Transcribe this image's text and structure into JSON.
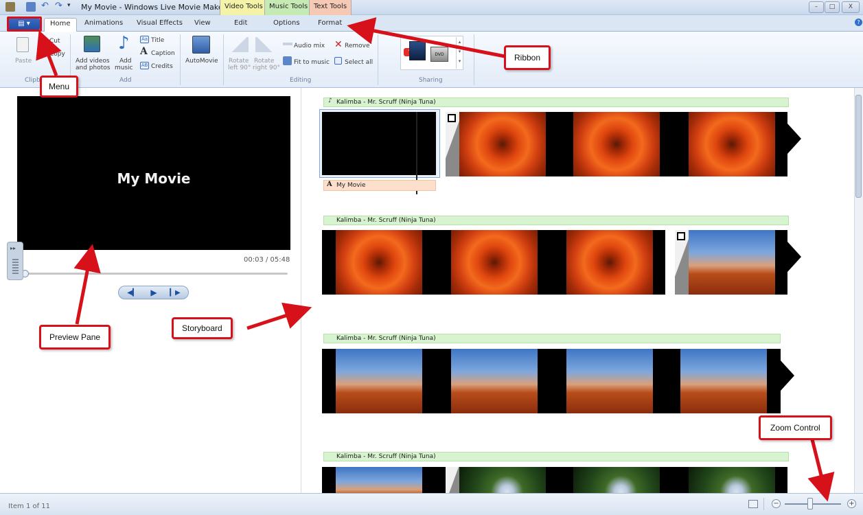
{
  "window": {
    "title": "My Movie - Windows Live Movie Maker",
    "context_tabs": {
      "video": "Video Tools",
      "music": "Music Tools",
      "text": "Text Tools"
    },
    "minimize": "–",
    "maximize": "□",
    "close": "X"
  },
  "tabs": [
    {
      "label": "Home"
    },
    {
      "label": "Animations"
    },
    {
      "label": "Visual Effects"
    },
    {
      "label": "View"
    },
    {
      "label": "Edit"
    },
    {
      "label": "Options"
    },
    {
      "label": "Format"
    }
  ],
  "ribbon": {
    "clipboard": {
      "paste": "Paste",
      "cut": "Cut",
      "copy": "Copy",
      "group": "Clipb"
    },
    "add": {
      "add_videos_1": "Add videos",
      "add_videos_2": "and photos",
      "add_music_1": "Add",
      "add_music_2": "music",
      "title": "Title",
      "caption": "Caption",
      "credits": "Credits",
      "group": "Add"
    },
    "automovie": "AutoMovie",
    "editing": {
      "rotate_left_1": "Rotate",
      "rotate_left_2": "left 90°",
      "rotate_right_1": "Rotate",
      "rotate_right_2": "right 90°",
      "audio_mix": "Audio mix",
      "remove": "Remove",
      "fit_to_music": "Fit to music",
      "select_all": "Select all",
      "group": "Editing"
    },
    "sharing": {
      "youtube": "You Tube",
      "dvd": "DVD",
      "group": "Sharing"
    }
  },
  "preview": {
    "caption": "My Movie",
    "timecode": "00:03 / 05:48"
  },
  "storyboard": {
    "music_label": "Kalimba - Mr. Scruff (Ninja Tuna)",
    "title_clip_label": "My Movie"
  },
  "status": {
    "item_count": "Item 1 of 11"
  },
  "zoom": {
    "minus": "−",
    "plus": "+",
    "level": 0.45
  },
  "callouts": {
    "menu": "Menu",
    "ribbon": "Ribbon",
    "preview_pane": "Preview Pane",
    "storyboard": "Storyboard",
    "zoom_control": "Zoom Control"
  },
  "colors": {
    "callout_red": "#d6111a",
    "music_bar": "#d8f3cf",
    "title_bar": "#fde0cc"
  }
}
